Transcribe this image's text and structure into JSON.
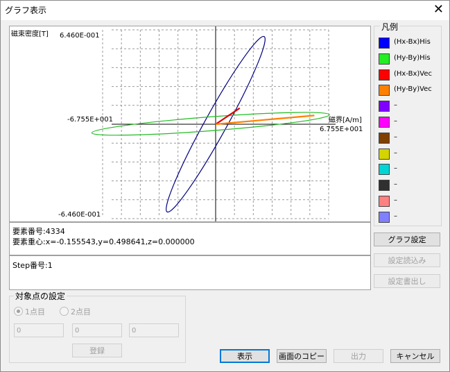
{
  "window": {
    "title": "グラフ表示",
    "close_glyph": "✕"
  },
  "plot": {
    "y_max_label": "6.460E-001",
    "y_min_label": "-6.460E-001",
    "x_min_label": "-6.755E+001",
    "x_max_label": "6.755E+001",
    "y_axis_title": "磁束密度[T]",
    "x_axis_title": "磁界[A/m]"
  },
  "chart_data": {
    "type": "line",
    "xlim": [
      -67.55,
      67.55
    ],
    "ylim": [
      -0.646,
      0.646
    ],
    "grid": true,
    "series": [
      {
        "name": "(Hx-Bx)His",
        "color": "#000080",
        "kind": "loop",
        "center": [
          0,
          0
        ],
        "tip": [
          29.0,
          0.6
        ],
        "minor_half_width": 6.5
      },
      {
        "name": "(Hy-By)His",
        "color": "#22bb22",
        "kind": "loop",
        "center": [
          -3.0,
          0.003
        ],
        "tip": [
          68.0,
          0.065
        ],
        "minor_half_width": 0.0475
      },
      {
        "name": "(Hx-Bx)Vec",
        "color": "#dd0000",
        "kind": "vector",
        "x": [
          0,
          14.4
        ],
        "y": [
          0,
          0.11
        ]
      },
      {
        "name": "(Hy-By)Vec",
        "color": "#ff8000",
        "kind": "vector",
        "x": [
          0,
          59.0
        ],
        "y": [
          0,
          0.06
        ]
      }
    ]
  },
  "info": {
    "element_number_label": "要素番号:",
    "element_number": "4334",
    "centroid_label": "要素重心:",
    "centroid": "x=-0.155543,y=0.498641,z=0.000000",
    "step_label": "Step番号:",
    "step": "1"
  },
  "legend": {
    "title": "凡例",
    "items": [
      {
        "label": "(Hx-Bx)His",
        "color": "#0000ff"
      },
      {
        "label": "(Hy-By)His",
        "color": "#22ee22"
      },
      {
        "label": "(Hx-Bx)Vec",
        "color": "#ff0000"
      },
      {
        "label": "(Hy-By)Vec",
        "color": "#ff8000"
      },
      {
        "label": "–",
        "color": "#8000ff"
      },
      {
        "label": "–",
        "color": "#ff00ff"
      },
      {
        "label": "–",
        "color": "#804000"
      },
      {
        "label": "–",
        "color": "#d4d400"
      },
      {
        "label": "–",
        "color": "#00d4d4"
      },
      {
        "label": "–",
        "color": "#303030"
      },
      {
        "label": "–",
        "color": "#ff8080"
      },
      {
        "label": "–",
        "color": "#8080ff"
      }
    ]
  },
  "side_buttons": {
    "graph_settings": "グラフ設定",
    "load_settings": "設定読込み",
    "save_settings": "設定書出し"
  },
  "target": {
    "group_title": "対象点の設定",
    "radio1": "1点目",
    "radio2": "2点目",
    "fields": [
      "0",
      "0",
      "0"
    ],
    "register": "登録"
  },
  "bottom_buttons": {
    "show": "表示",
    "copy_screen": "画面のコピー",
    "output": "出力",
    "cancel": "キャンセル"
  }
}
